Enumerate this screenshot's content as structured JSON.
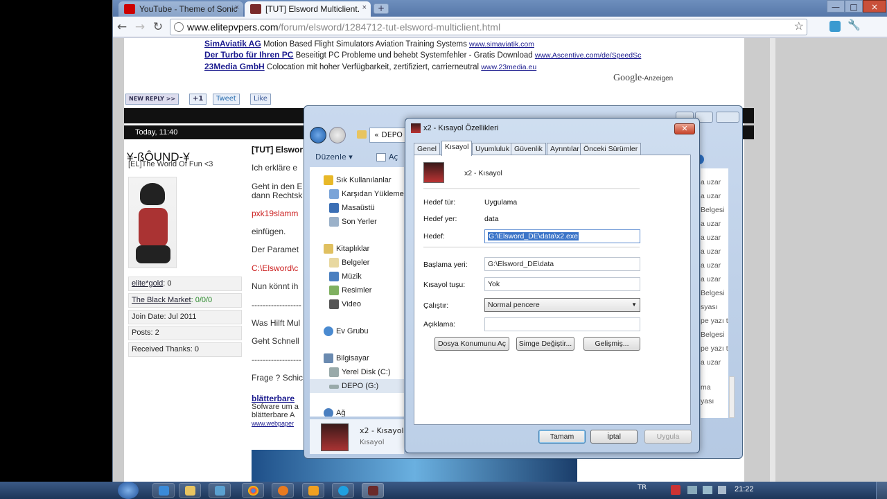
{
  "browser": {
    "tabs": [
      {
        "label": "YouTube - Theme of Sonic",
        "active": false
      },
      {
        "label": "[TUT] Elsword Multiclient.",
        "active": true
      }
    ],
    "url_domain": "www.elitepvpers.com",
    "url_path": "/forum/elsword/1284712-tut-elsword-multiclient.html",
    "back_glyph": "←",
    "forward_glyph": "→",
    "reload_glyph": "↻",
    "star_glyph": "☆",
    "wrench_glyph": "🔧",
    "newtab_glyph": "+",
    "close_glyph": "×",
    "minimize_glyph": "—",
    "maximize_glyph": "□"
  },
  "ads": [
    {
      "title": "SimAviatik AG",
      "text": "Motion Based Flight Simulators Aviation Training Systems",
      "url": "www.simaviatik.com"
    },
    {
      "title": "Der Turbo für Ihren PC",
      "text": "Beseitigt PC Probleme und behebt Systemfehler - Gratis Download",
      "url": "www.Ascentive.com/de/SpeedSc"
    },
    {
      "title": "23Media GmbH",
      "text": "Colocation mit hoher Verfügbarkeit, zertifiziert, carrierneutral",
      "url": "www.23media.eu"
    }
  ],
  "google_ads": {
    "brand": "Google",
    "suffix": "-Anzeigen"
  },
  "post_buttons": {
    "reply": "NEW REPLY",
    "reply_arrow": ">>",
    "plus": "+1",
    "tweet": "Tweet",
    "like": "Like"
  },
  "post": {
    "date": "Today, 11:40",
    "username": "¥-ßÔUND-¥",
    "usertitle": "[EL]The World Of Fun <3",
    "stats": [
      {
        "label": "elite*gold",
        "value": ": 0"
      },
      {
        "label": "The Black Market",
        "value": ": 0/0/0"
      },
      {
        "label": "Join Date: Jul 2011",
        "value": ""
      },
      {
        "label": "Posts: 2",
        "value": ""
      },
      {
        "label": "Received Thanks: 0",
        "value": ""
      }
    ],
    "title": "[TUT] Elswor",
    "lines": [
      "Ich erkläre e",
      "Geht in den E",
      "dann Rechtsk",
      "pxk19slamm",
      "einfügen.",
      "Der Paramet",
      "C:\\Elsword\\c",
      "Nun könnt ih",
      "------------------",
      "Was Hilft Mul",
      "Geht Schnell",
      "------------------",
      "Frage ? Schic"
    ],
    "sig_title": "blätterbare",
    "sig_line1": "Sofware um a",
    "sig_line2": "blätterbare A",
    "sig_url": "www.webpaper"
  },
  "explorer": {
    "address": "«  DEPO (G",
    "organize": "Düzenle ▾",
    "open": "Aç",
    "nav": [
      {
        "label": "Sık Kullanılanlar",
        "indent": 0,
        "color": "#e8b828"
      },
      {
        "label": "Karşıdan Yükleme",
        "indent": 1,
        "color": "#7aa4d8"
      },
      {
        "label": "Masaüstü",
        "indent": 1,
        "color": "#3b6fb5"
      },
      {
        "label": "Son Yerler",
        "indent": 1,
        "color": "#9bb1c9"
      },
      {
        "label": "Kitaplıklar",
        "indent": 0,
        "color": "#e0c060"
      },
      {
        "label": "Belgeler",
        "indent": 1,
        "color": "#e8d8a0"
      },
      {
        "label": "Müzik",
        "indent": 1,
        "color": "#4a7fc0"
      },
      {
        "label": "Resimler",
        "indent": 1,
        "color": "#7fb060"
      },
      {
        "label": "Video",
        "indent": 1,
        "color": "#555"
      },
      {
        "label": "Ev Grubu",
        "indent": 0,
        "color": "#4a8ad0"
      },
      {
        "label": "Bilgisayar",
        "indent": 0,
        "color": "#6a8ab0"
      },
      {
        "label": "Yerel Disk (C:)",
        "indent": 1,
        "color": "#9aa"
      },
      {
        "label": "DEPO (G:)",
        "indent": 1,
        "color": "#9aa"
      },
      {
        "label": "Ağ",
        "indent": 0,
        "color": "#4a7fc0"
      }
    ],
    "right_items": [
      "a uzar",
      "a uzar",
      "Belgesi",
      "a uzar",
      "a uzar",
      "a uzar",
      "a uzar",
      "a uzar",
      "Belgesi",
      "syası",
      "pe yazı t",
      "Belgesi",
      "pe yazı t",
      "a uzar",
      "ma",
      "yası"
    ],
    "details_name": "x2 - Kısayol",
    "details_type": "Kısayol"
  },
  "dialog": {
    "title": "x2 - Kısayol Özellikleri",
    "tabs": [
      "Genel",
      "Kısayol",
      "Uyumluluk",
      "Güvenlik",
      "Ayrıntılar",
      "Önceki Sürümler"
    ],
    "shortcut_name": "x2 - Kısayol",
    "target_type_label": "Hedef tür:",
    "target_type": "Uygulama",
    "target_loc_label": "Hedef yer:",
    "target_loc": "data",
    "target_label": "Hedef:",
    "target": "G:\\Elsword_DE\\data\\x2.exe",
    "start_label": "Başlama yeri:",
    "start": "G:\\Elsword_DE\\data",
    "hotkey_label": "Kısayol tuşu:",
    "hotkey": "Yok",
    "run_label": "Çalıştır:",
    "run": "Normal pencere",
    "comment_label": "Açıklama:",
    "comment": "",
    "btn_location": "Dosya Konumunu Aç",
    "btn_icon": "Simge Değiştir...",
    "btn_advanced": "Gelişmiş...",
    "ok": "Tamam",
    "cancel": "İptal",
    "apply": "Uygula"
  },
  "taskbar": {
    "lang": "TR",
    "time": "21:22"
  }
}
